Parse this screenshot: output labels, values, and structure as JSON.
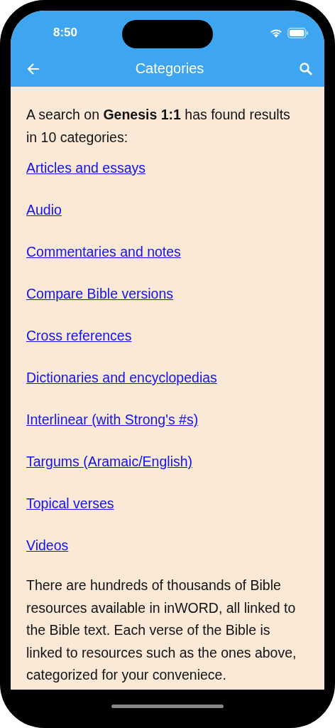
{
  "status_bar": {
    "time": "8:50"
  },
  "header": {
    "title": "Categories"
  },
  "intro": "A search on **Genesis 1:1** has found results in 10 categories:",
  "links": [
    {
      "label": "Articles and essays"
    },
    {
      "label": "Audio"
    },
    {
      "label": "Commentaries and notes"
    },
    {
      "label": "Compare Bible versions"
    },
    {
      "label": "Cross references"
    },
    {
      "label": "Dictionaries and encyclopedias"
    },
    {
      "label": "Interlinear (with Strong's #s)"
    },
    {
      "label": "Targums (Aramaic/English)"
    },
    {
      "label": "Topical verses"
    },
    {
      "label": "Videos"
    }
  ],
  "footer": "There are hundreds of thousands of Bible resources available in inWORD, all linked to the Bible text. Each verse of the Bible is linked to resources such as the ones above, categorized for your conveniece."
}
